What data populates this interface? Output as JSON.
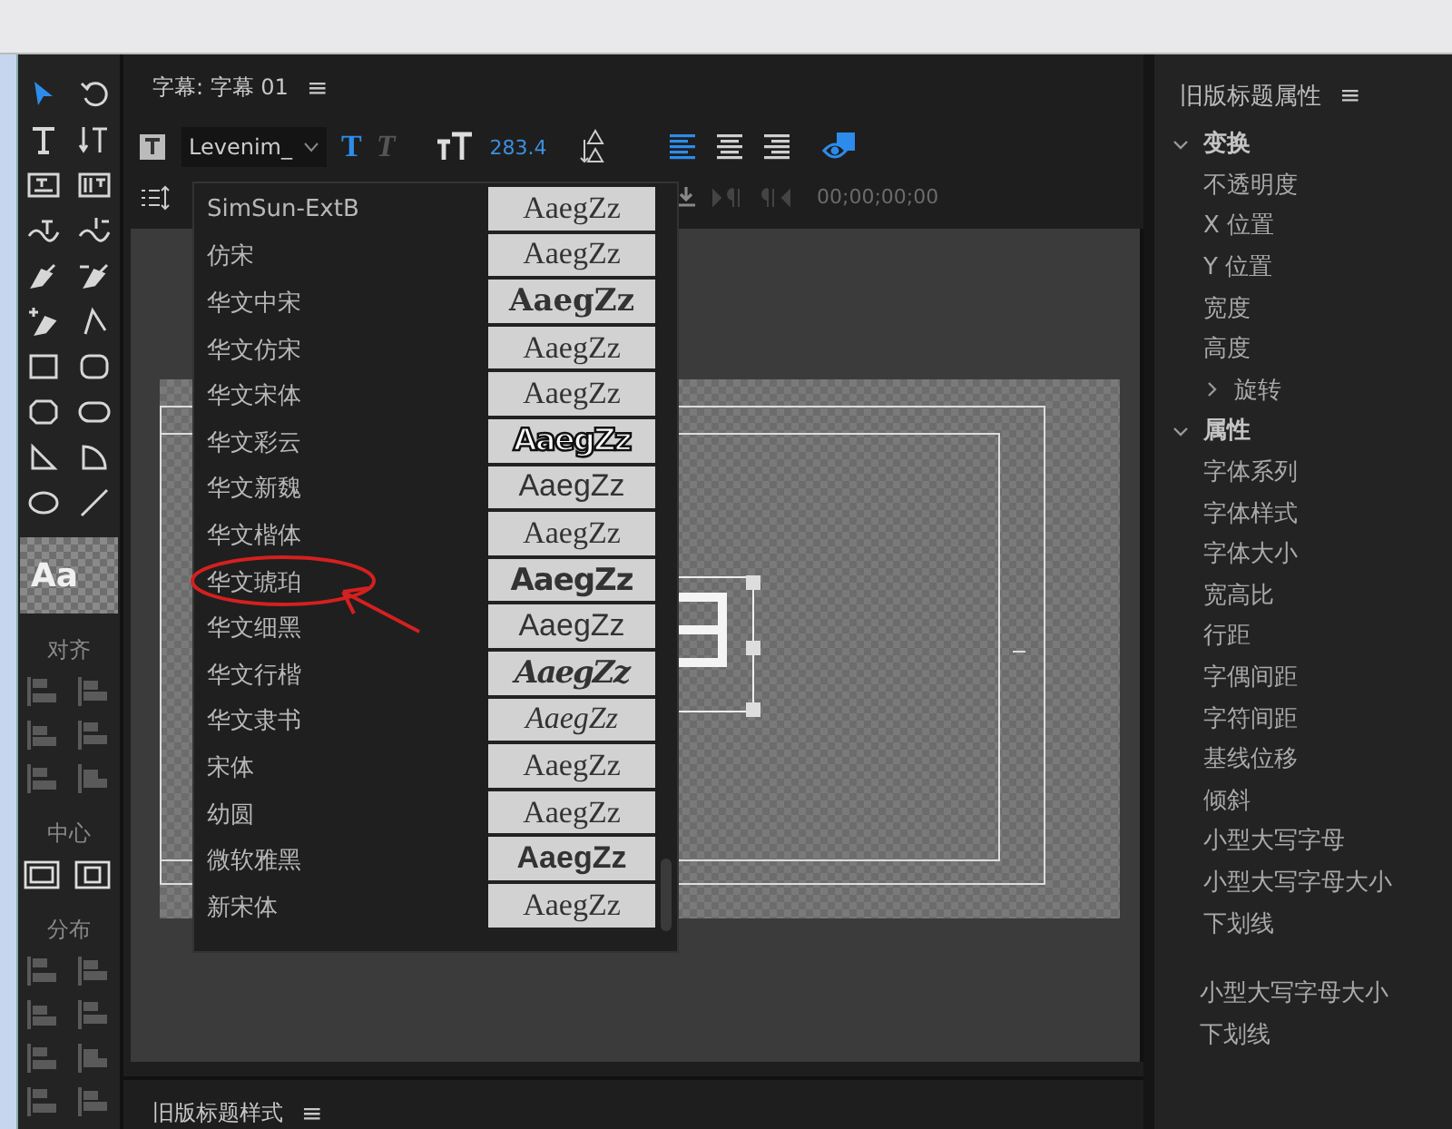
{
  "title_panel": {
    "title": "字幕: 字幕 01",
    "menu": "≡"
  },
  "tools": [
    {
      "kind": "pointer",
      "selected": true
    },
    {
      "kind": "rotate",
      "selected": false
    },
    {
      "kind": "type",
      "selected": false
    },
    {
      "kind": "vtype",
      "selected": false
    },
    {
      "kind": "area",
      "selected": false
    },
    {
      "kind": "varea",
      "selected": false
    },
    {
      "kind": "path",
      "selected": false
    },
    {
      "kind": "vpath",
      "selected": false
    },
    {
      "kind": "pen",
      "selected": false
    },
    {
      "kind": "delpen",
      "selected": false
    },
    {
      "kind": "addpen",
      "selected": false
    },
    {
      "kind": "convert",
      "selected": false
    },
    {
      "kind": "rect",
      "selected": false
    },
    {
      "kind": "rrect",
      "selected": false
    },
    {
      "kind": "clip",
      "selected": false
    },
    {
      "kind": "oval",
      "selected": false
    },
    {
      "kind": "wedge",
      "selected": false
    },
    {
      "kind": "arc",
      "selected": false
    },
    {
      "kind": "ellipse",
      "selected": false
    },
    {
      "kind": "line",
      "selected": false
    }
  ],
  "style_swatch": "Aa",
  "tool_sections": [
    {
      "label": "对齐",
      "kind": "align"
    },
    {
      "label": "中心",
      "kind": "center"
    },
    {
      "label": "分布",
      "kind": "distribute"
    }
  ],
  "toolbar": {
    "font_family": "Levenim_",
    "bold_label": "T",
    "bold": true,
    "italic_label": "T",
    "italic": false,
    "font_size": "283.4",
    "align": [
      {
        "kind": "left",
        "selected": true
      },
      {
        "kind": "center",
        "selected": false
      },
      {
        "kind": "right",
        "selected": false
      }
    ],
    "show_video": true,
    "timecode": "00;00;00;00"
  },
  "font_list": [
    {
      "name": "SimSun-ExtB",
      "preview": "AaegZz",
      "kind": "serif",
      "circled": false
    },
    {
      "name": "仿宋",
      "preview": "AaegZz",
      "kind": "serif",
      "circled": false
    },
    {
      "name": "华文中宋",
      "preview": "AaegZz",
      "kind": "serif-bold",
      "circled": false
    },
    {
      "name": "华文仿宋",
      "preview": "AaegZz",
      "kind": "serif",
      "circled": false
    },
    {
      "name": "华文宋体",
      "preview": "AaegZz",
      "kind": "serif",
      "circled": false
    },
    {
      "name": "华文彩云",
      "preview": "AaegZz",
      "kind": "outline",
      "circled": false
    },
    {
      "name": "华文新魏",
      "preview": "AaegZz",
      "kind": "sans",
      "circled": false
    },
    {
      "name": "华文楷体",
      "preview": "AaegZz",
      "kind": "serif",
      "circled": false
    },
    {
      "name": "华文琥珀",
      "preview": "AaegZz",
      "kind": "heavy",
      "circled": true
    },
    {
      "name": "华文细黑",
      "preview": "AaegZz",
      "kind": "sans",
      "circled": false
    },
    {
      "name": "华文行楷",
      "preview": "AaegZz",
      "kind": "script",
      "circled": false
    },
    {
      "name": "华文隶书",
      "preview": "AaegZz",
      "kind": "italic",
      "circled": false
    },
    {
      "name": "宋体",
      "preview": "AaegZz",
      "kind": "serif",
      "circled": false
    },
    {
      "name": "幼圆",
      "preview": "AaegZz",
      "kind": "serif",
      "circled": false
    },
    {
      "name": "微软雅黑",
      "preview": "AaegZz",
      "kind": "sans-bold",
      "circled": false
    },
    {
      "name": "新宋体",
      "preview": "AaegZz",
      "kind": "serif",
      "circled": false
    }
  ],
  "properties_panel": {
    "title": "旧版标题属性",
    "menu": "≡",
    "groups": [
      {
        "label": "变换",
        "expanded": true,
        "children": [
          {
            "label": "不透明度"
          },
          {
            "label": "X 位置"
          },
          {
            "label": "Y 位置"
          },
          {
            "label": "宽度"
          },
          {
            "label": "高度"
          },
          {
            "label": "旋转",
            "expanded": false
          }
        ]
      },
      {
        "label": "属性",
        "expanded": true,
        "children": [
          {
            "label": "字体系列"
          },
          {
            "label": "字体样式"
          },
          {
            "label": "字体大小"
          },
          {
            "label": "宽高比"
          },
          {
            "label": "行距"
          },
          {
            "label": "字偶间距"
          },
          {
            "label": "字符间距"
          },
          {
            "label": "基线位移"
          },
          {
            "label": "倾斜"
          },
          {
            "label": "小型大写字母"
          },
          {
            "label": "小型大写字母大小"
          },
          {
            "label": "下划线"
          }
        ]
      }
    ],
    "overlap_items": [
      "小型大写字母大小",
      "下划线"
    ]
  },
  "styles_panel": {
    "title": "旧版标题样式",
    "menu": "≡"
  }
}
